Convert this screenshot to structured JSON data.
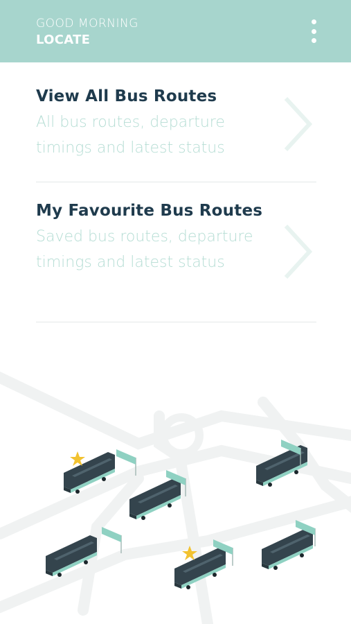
{
  "header": {
    "greeting": "GOOD MORNING",
    "app_name": "LOCATE",
    "menu_icon": "kebab-menu-icon"
  },
  "menu": [
    {
      "title": "View All Bus Routes",
      "description": "All bus routes, departure timings and latest status",
      "icon": "chevron-right-icon"
    },
    {
      "title": "My Favourite Bus Routes",
      "description": "Saved bus routes, departure timings and latest status",
      "icon": "chevron-right-icon"
    }
  ],
  "colors": {
    "header_bg": "#a7d5cd",
    "title_text": "#1f3b4d",
    "desc_text": "#b5ddd4",
    "bus_body": "#34444d",
    "bus_accent": "#8fd1c2",
    "star": "#f2c230"
  }
}
